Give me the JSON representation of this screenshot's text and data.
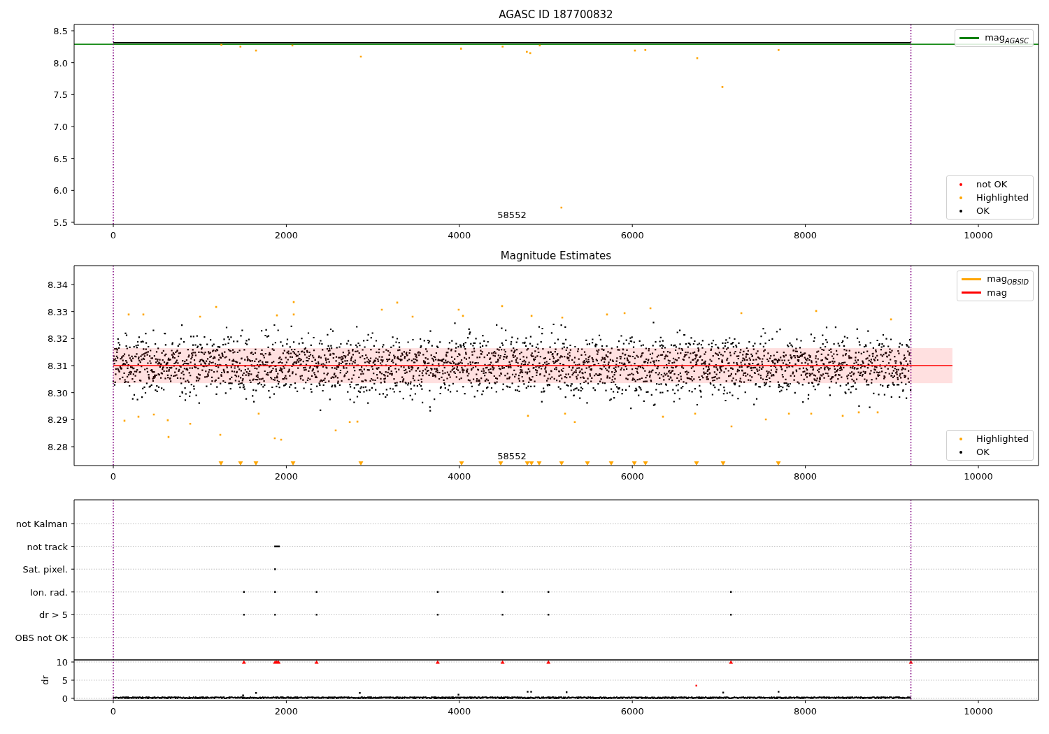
{
  "panels": [
    {
      "title": "AGASC ID 187700832",
      "annotation": "58552",
      "y_tick_labels": [
        "8.5",
        "8.0",
        "7.5",
        "7.0",
        "6.5",
        "6.0",
        "5.5"
      ],
      "x_tick_labels": [
        "0",
        "2000",
        "4000",
        "6000",
        "8000",
        "10000"
      ],
      "legends": [
        {
          "items": [
            {
              "kind": "line",
              "label": "mag$_{AGASC}$",
              "color": "#008000"
            }
          ]
        },
        {
          "items": [
            {
              "kind": "point",
              "label": "not OK",
              "color": "#ff0000"
            },
            {
              "kind": "point",
              "label": "Highlighted",
              "color": "#ffa500"
            },
            {
              "kind": "point",
              "label": "OK",
              "color": "#000000"
            }
          ]
        }
      ]
    },
    {
      "title": "Magnitude Estimates",
      "annotation": "58552",
      "y_tick_labels": [
        "8.34",
        "8.33",
        "8.32",
        "8.31",
        "8.30",
        "8.29",
        "8.28"
      ],
      "x_tick_labels": [
        "0",
        "2000",
        "4000",
        "6000",
        "8000",
        "10000"
      ],
      "legends": [
        {
          "items": [
            {
              "kind": "line",
              "label": "mag$_{OBSID}$",
              "color": "#ffa500"
            },
            {
              "kind": "line",
              "label": "mag",
              "color": "#ff0000"
            }
          ]
        },
        {
          "items": [
            {
              "kind": "point",
              "label": "Highlighted",
              "color": "#ffa500"
            },
            {
              "kind": "point",
              "label": "OK",
              "color": "#000000"
            }
          ]
        }
      ]
    },
    {
      "flag_labels": [
        "not Kalman",
        "not track",
        "Sat. pixel.",
        "Ion. rad.",
        "dr > 5",
        "OBS not OK"
      ],
      "y_label": "dr",
      "y_tick_labels": [
        "10",
        "5",
        "0"
      ],
      "x_tick_labels": [
        "0",
        "2000",
        "4000",
        "6000",
        "8000",
        "10000"
      ]
    }
  ]
}
